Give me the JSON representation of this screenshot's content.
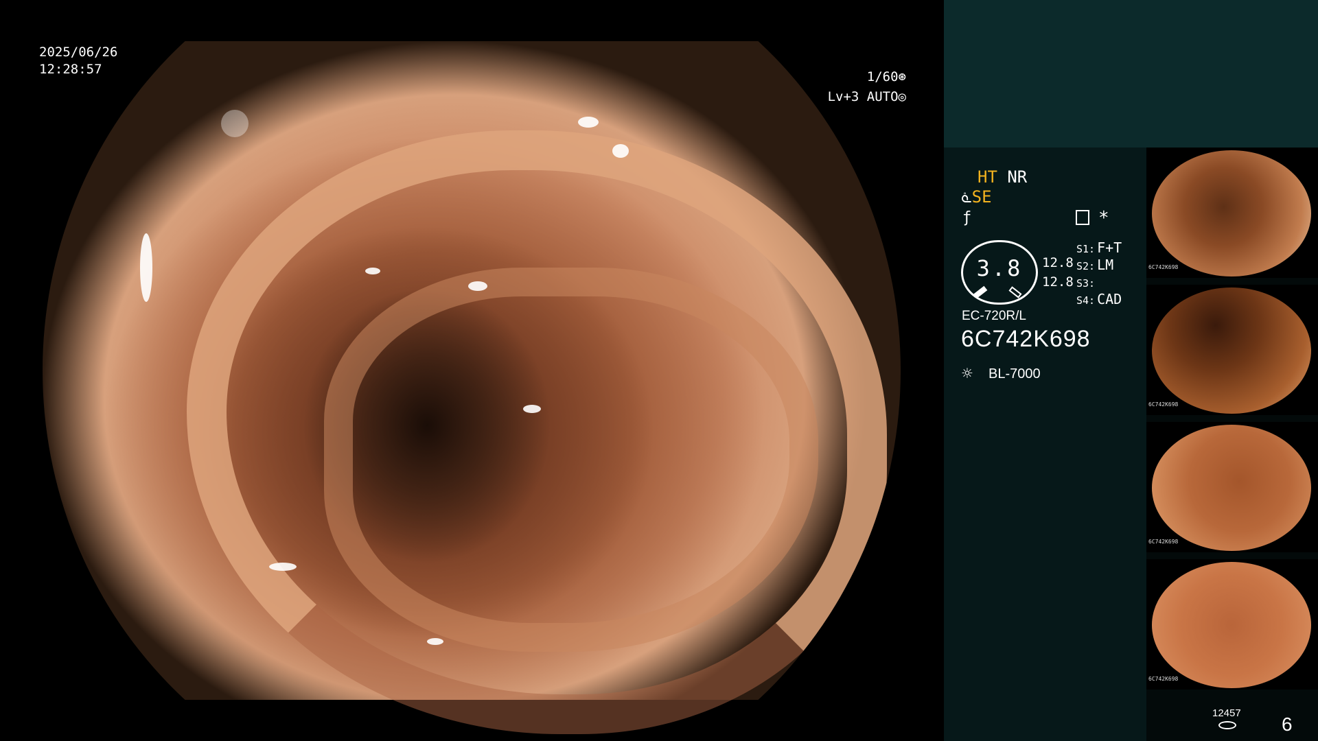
{
  "overlay": {
    "date": "2025/06/26",
    "time": "12:28:57",
    "shutter": "1/60",
    "level": "Lv+3 AUTO"
  },
  "panel": {
    "ht": "HT",
    "nr": "NR",
    "se": "SE",
    "star": "*",
    "gauge_value": "3.8",
    "value_top": "12.8",
    "value_bottom": "12.8",
    "switches": [
      {
        "key": "S1:",
        "value": "F+T"
      },
      {
        "key": "S2:",
        "value": "LM"
      },
      {
        "key": "S3:",
        "value": ""
      },
      {
        "key": "S4:",
        "value": "CAD"
      }
    ],
    "scope_model": "EC-720R/L",
    "serial": "6C742K698",
    "light_source": "BL-7000",
    "highlight_color": "#f2b21f"
  },
  "thumbnails": [
    {
      "caption": "6C742K698"
    },
    {
      "caption": "6C742K698"
    },
    {
      "caption": "6C742K698"
    },
    {
      "caption": "6C742K698"
    }
  ],
  "footer": {
    "image_count": "12457",
    "page_number": "6"
  },
  "icons": [
    "shutter-icon",
    "auto-icon",
    "scope-icon",
    "f-icon",
    "record-icon",
    "light-icon",
    "disk-icon"
  ]
}
